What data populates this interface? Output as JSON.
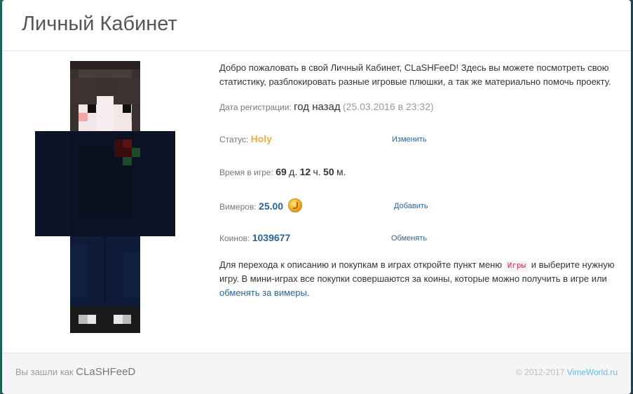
{
  "panel": {
    "title": "Личный Кабинет"
  },
  "intro": "Добро пожаловать в свой Личный Кабинет, CLaSHFeeD! Здесь вы можете посмотреть свою статистику, разблокировать разные игровые плюшки, а так же материально помочь проекту.",
  "registration": {
    "label": "Дата регистрации:",
    "relative": "год назад",
    "exact": "(25.03.2016 в 23:32)"
  },
  "status": {
    "label": "Статус:",
    "value": "Holy",
    "action": "Изменить"
  },
  "playtime": {
    "label": "Время в игре:",
    "days": "69",
    "days_unit": "д.",
    "hours": "12",
    "hours_unit": "ч.",
    "minutes": "50",
    "minutes_unit": "м."
  },
  "vimers": {
    "label": "Вимеров:",
    "value": "25.00",
    "icon": "coin-icon",
    "action": "Добавить"
  },
  "coins": {
    "label": "Коинов:",
    "value": "1039677",
    "action": "Обменять"
  },
  "outro": {
    "part1": "Для перехода к описанию и покупкам в играх откройте пункт меню",
    "menu_chip": "Игры",
    "part2": "и выберите нужную игру. В мини-играх все покупки совершаются за коины, которые можно получить в игре или",
    "link": "обменять за вимеры",
    "part3": "."
  },
  "footer": {
    "prefix": "Вы зашли как",
    "username": "CLaSHFeeD",
    "copyright": "© 2012-2017",
    "site_link": "VimeWorld.ru"
  },
  "colors": {
    "status_holy": "#f0ad4e",
    "link": "#2a6496",
    "footer_link": "#5bc0de"
  }
}
